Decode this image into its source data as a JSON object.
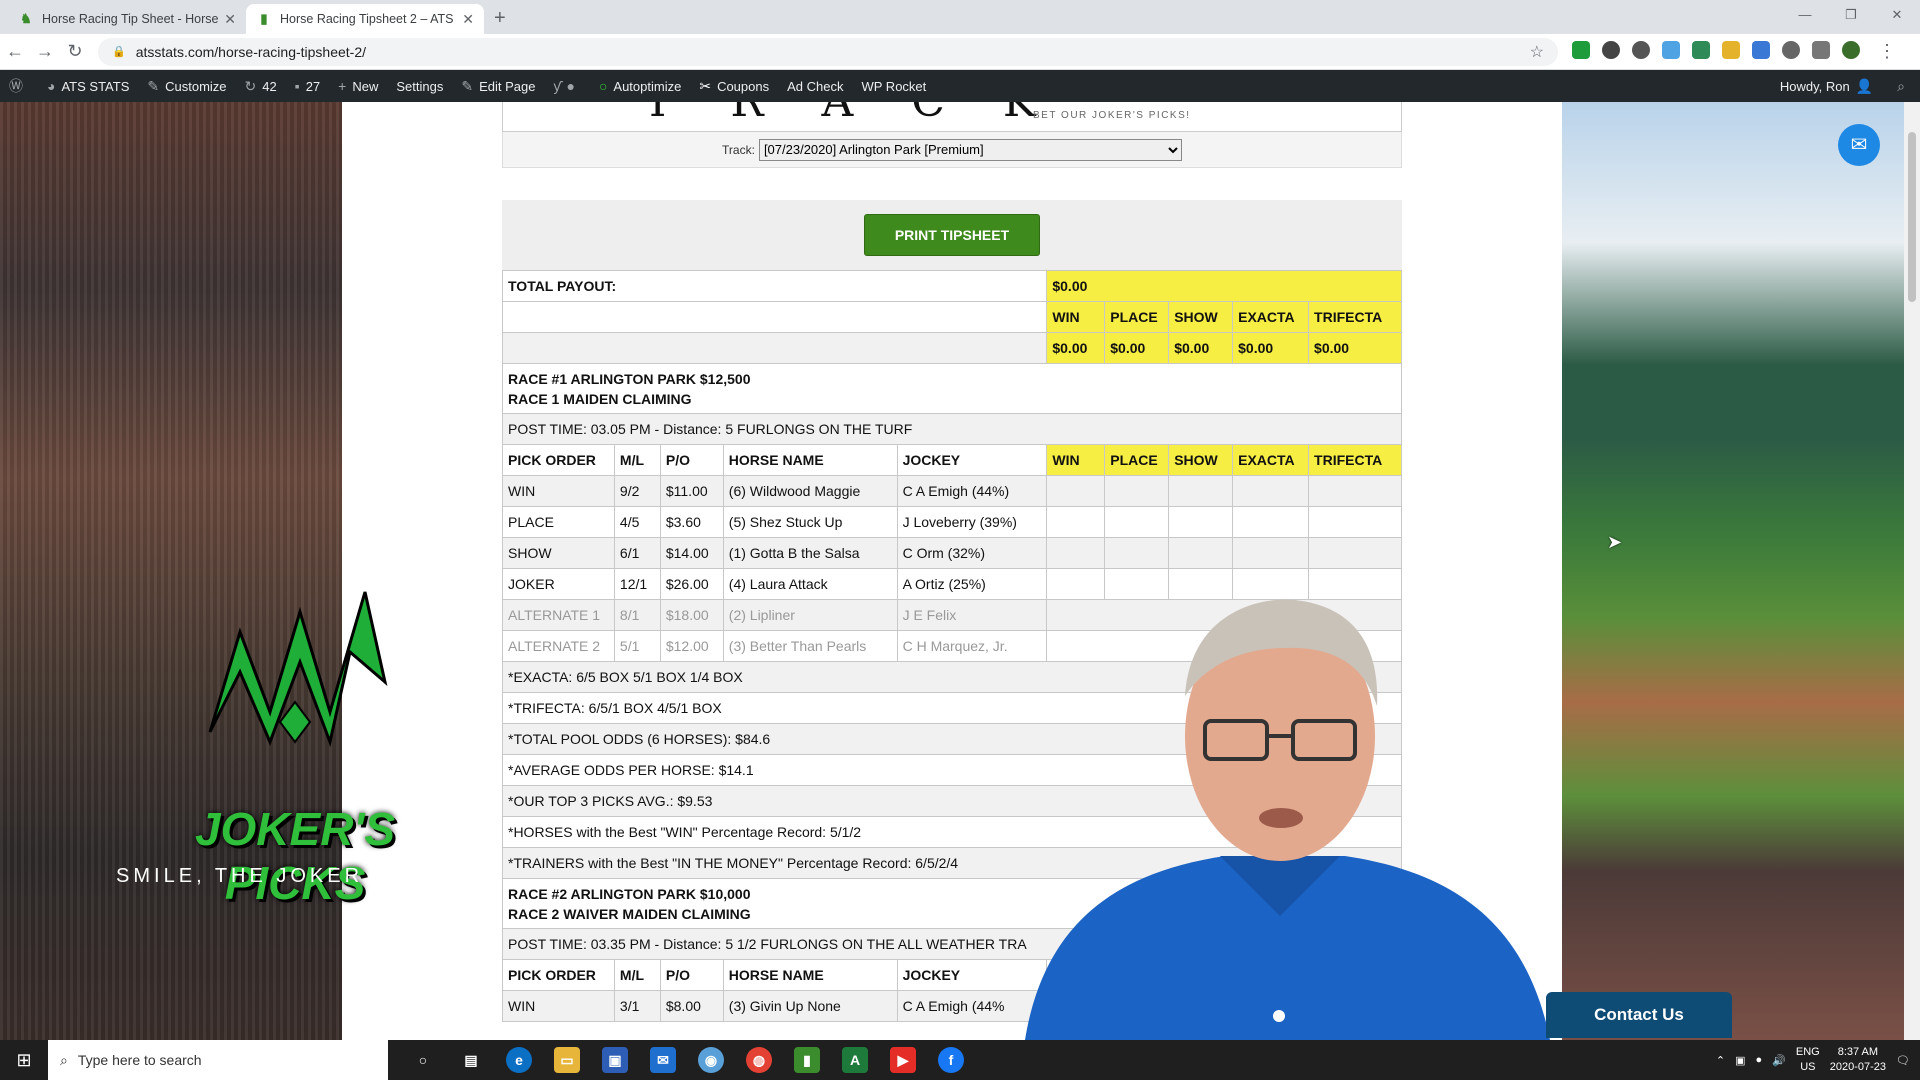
{
  "browser": {
    "tabs": [
      {
        "title": "Horse Racing Tip Sheet - Horse R"
      },
      {
        "title": "Horse Racing Tipsheet 2 – ATS S"
      }
    ],
    "url": "atsstats.com/horse-racing-tipsheet-2/"
  },
  "wp_admin": {
    "site": "ATS STATS",
    "customize": "Customize",
    "updates": "42",
    "comments": "27",
    "new": "New",
    "settings": "Settings",
    "edit_page": "Edit Page",
    "autoptimize": "Autoptimize",
    "coupons": "Coupons",
    "ad_check": "Ad Check",
    "wp_rocket": "WP Rocket",
    "howdy": "Howdy, Ron"
  },
  "header": {
    "title_fragment": "T R A C K",
    "tagline": "BET OUR JOKER'S PICKS!"
  },
  "track": {
    "label": "Track:",
    "selected": "[07/23/2020] Arlington Park [Premium]"
  },
  "print_button": "PRINT TIPSHEET",
  "payout": {
    "label": "TOTAL PAYOUT:",
    "total": "$0.00",
    "headers": [
      "WIN",
      "PLACE",
      "SHOW",
      "EXACTA",
      "TRIFECTA"
    ],
    "values": [
      "$0.00",
      "$0.00",
      "$0.00",
      "$0.00",
      "$0.00"
    ]
  },
  "race1": {
    "title_line1": "RACE #1 ARLINGTON PARK $12,500",
    "title_line2": "RACE 1 MAIDEN CLAIMING",
    "post": "POST TIME: 03.05 PM - Distance: 5 FURLONGS ON THE TURF",
    "headers": [
      "PICK ORDER",
      "M/L",
      "P/O",
      "HORSE NAME",
      "JOCKEY",
      "WIN",
      "PLACE",
      "SHOW",
      "EXACTA",
      "TRIFECTA"
    ],
    "rows": [
      {
        "pick": "WIN",
        "ml": "9/2",
        "po": "$11.00",
        "horse": "(6) Wildwood Maggie",
        "jockey": "C A Emigh (44%)"
      },
      {
        "pick": "PLACE",
        "ml": "4/5",
        "po": "$3.60",
        "horse": "(5) Shez Stuck Up",
        "jockey": "J Loveberry (39%)"
      },
      {
        "pick": "SHOW",
        "ml": "6/1",
        "po": "$14.00",
        "horse": "(1) Gotta B the Salsa",
        "jockey": "C Orm (32%)"
      },
      {
        "pick": "JOKER",
        "ml": "12/1",
        "po": "$26.00",
        "horse": "(4) Laura Attack",
        "jockey": "A Ortiz (25%)"
      },
      {
        "pick": "ALTERNATE 1",
        "ml": "8/1",
        "po": "$18.00",
        "horse": "(2) Lipliner",
        "jockey": "J E Felix"
      },
      {
        "pick": "ALTERNATE 2",
        "ml": "5/1",
        "po": "$12.00",
        "horse": "(3) Better Than Pearls",
        "jockey": "C H Marquez, Jr."
      }
    ],
    "notes": [
      "*EXACTA: 6/5 BOX 5/1 BOX 1/4 BOX",
      "*TRIFECTA: 6/5/1 BOX 4/5/1 BOX",
      "*TOTAL POOL ODDS (6 HORSES): $84.6",
      "*AVERAGE ODDS PER HORSE: $14.1",
      "*OUR TOP 3 PICKS AVG.: $9.53",
      "*HORSES with the Best \"WIN\" Percentage Record: 5/1/2",
      "*TRAINERS with the Best \"IN THE MONEY\" Percentage Record: 6/5/2/4"
    ]
  },
  "race2": {
    "title_line1": "RACE #2 ARLINGTON PARK $10,000",
    "title_line2": "RACE 2 WAIVER MAIDEN CLAIMING",
    "post": "POST TIME: 03.35 PM - Distance: 5 1/2 FURLONGS ON THE ALL WEATHER TRA",
    "headers": [
      "PICK ORDER",
      "M/L",
      "P/O",
      "HORSE NAME",
      "JOCKEY"
    ],
    "rows": [
      {
        "pick": "WIN",
        "ml": "3/1",
        "po": "$8.00",
        "horse": "(3) Givin Up None",
        "jockey": "C A Emigh (44%"
      }
    ]
  },
  "promo": {
    "title": "JOKER'S PICKS",
    "subtitle": "SMILE, THE JOKER DID IT!"
  },
  "contact": "Contact Us",
  "taskbar": {
    "search_placeholder": "Type here to search",
    "lang": "ENG",
    "region": "US",
    "time": "8:37 AM",
    "date": "2020-07-23"
  }
}
